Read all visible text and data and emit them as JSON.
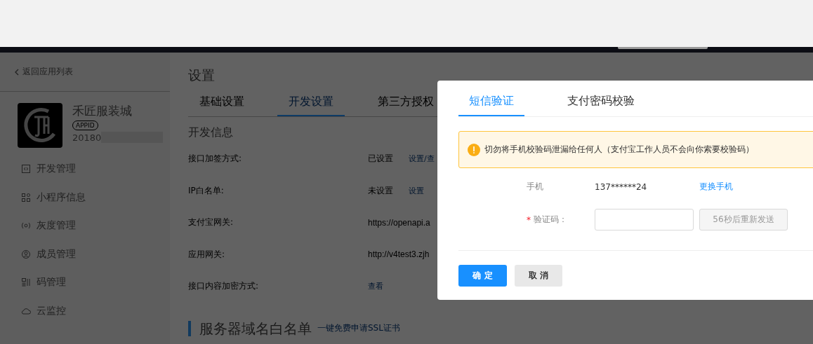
{
  "sidebar": {
    "back_link": "返回应用列表",
    "app": {
      "name": "禾匠服装城",
      "appid_label": "APPID",
      "appid": "20180"
    },
    "items": [
      {
        "label": "开发管理"
      },
      {
        "label": "小程序信息"
      },
      {
        "label": "灰度管理"
      },
      {
        "label": "成员管理"
      },
      {
        "label": "码管理"
      },
      {
        "label": "云监控"
      }
    ]
  },
  "main": {
    "title": "设置",
    "tabs": [
      {
        "label": "基础设置",
        "selected": false
      },
      {
        "label": "开发设置",
        "selected": true
      },
      {
        "label": "第三方授权",
        "selected": false
      }
    ],
    "section_title": "开发信息",
    "rows": [
      {
        "label": "接口加签方式:",
        "value": "已设置",
        "link": "设置/查"
      },
      {
        "label": "IP白名单:",
        "value": "未设置",
        "link": "设置"
      },
      {
        "label": "支付宝网关:",
        "value": "https://openapi.a"
      },
      {
        "label": "应用网关:",
        "value": "http://v4test3.zjh"
      },
      {
        "label": "接口内容加密方式:",
        "link": "查看"
      }
    ],
    "whitelist": {
      "title": "服务器域名白名单",
      "link": "一键免费申请SSL证书"
    }
  },
  "dialog": {
    "tabs": [
      {
        "label": "短信验证",
        "selected": true
      },
      {
        "label": "支付密码校验",
        "selected": false
      }
    ],
    "alert": "切勿将手机校验码泄漏给任何人（支付宝工作人员不会向你索要校验码）",
    "phone": {
      "label": "手机",
      "value": "137******24",
      "link": "更换手机"
    },
    "code": {
      "required_mark": "*",
      "label": "验证码：",
      "resend": "56秒后重新发送",
      "resend_disabled": true
    },
    "buttons": [
      {
        "label": "确 定",
        "kind": "primary"
      },
      {
        "label": "取 消",
        "kind": "default"
      }
    ]
  }
}
